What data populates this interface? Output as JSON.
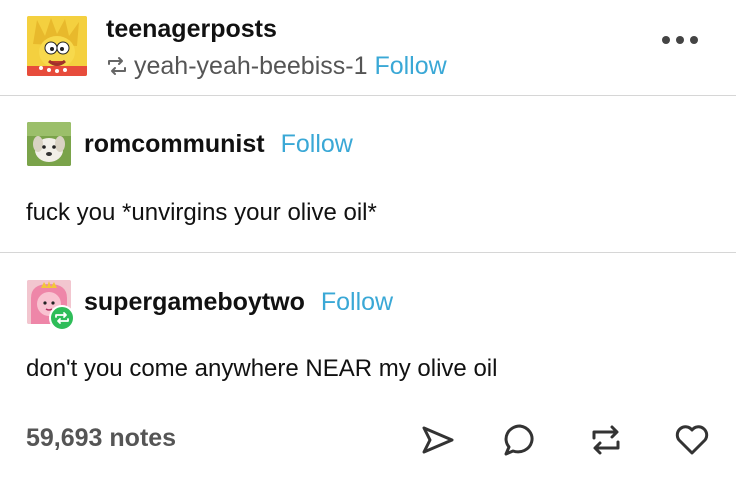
{
  "header": {
    "blog_name": "teenagerposts",
    "reblogged_from": "yeah-yeah-beebiss-1",
    "follow_label": "Follow",
    "avatar_icon": "lisa-simpson-avatar",
    "reblog_icon": "reblog-icon",
    "menu_icon": "more-options-icon"
  },
  "posts": [
    {
      "username": "romcommunist",
      "follow_label": "Follow",
      "text": "fuck you *unvirgins your olive oil*",
      "avatar_icon": "dog-avatar"
    },
    {
      "username": "supergameboytwo",
      "follow_label": "Follow",
      "text": "don't you come anywhere NEAR my olive oil",
      "avatar_icon": "princess-bubblegum-avatar",
      "badge_icon": "reblog-badge-icon"
    }
  ],
  "footer": {
    "notes": "59,693 notes",
    "actions": [
      "share-icon",
      "reply-icon",
      "reblog-icon",
      "like-icon"
    ]
  },
  "colors": {
    "accent": "#3aa8d6",
    "badge": "#2ebd59",
    "text": "#111111",
    "muted": "#555555",
    "divider": "#d6d6d6"
  }
}
